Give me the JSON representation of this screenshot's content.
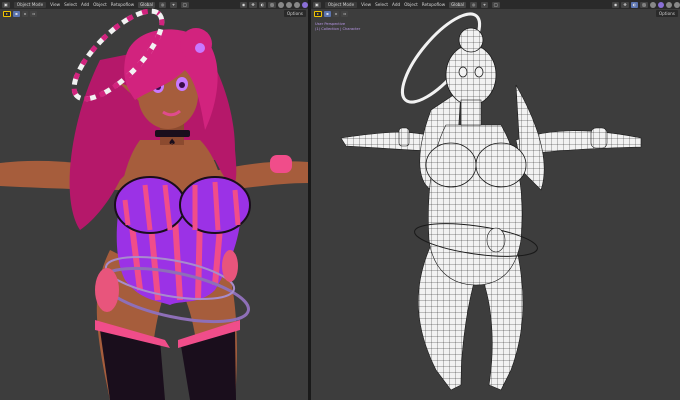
{
  "left_view": {
    "mode": "Object Mode",
    "menus": [
      "View",
      "Select",
      "Add",
      "Object"
    ],
    "extra_menu": "Retopoflow",
    "transform": "Global",
    "options": "Options",
    "colors": {
      "skin": "#a65d3c",
      "hair": "#d2237e",
      "outfit": "#9b32e6",
      "stripe": "#f04d8a",
      "boots": "#1a0e1c"
    }
  },
  "right_view": {
    "mode": "Object Mode",
    "menus": [
      "View",
      "Select",
      "Add",
      "Object"
    ],
    "extra_menu": "Retopoflow",
    "transform": "Global",
    "options": "Options",
    "info_lines": [
      "User Perspective",
      "(1) Collection | Character"
    ],
    "colors": {
      "mesh": "#f2f2f2",
      "wire": "#1a1a1a"
    }
  }
}
